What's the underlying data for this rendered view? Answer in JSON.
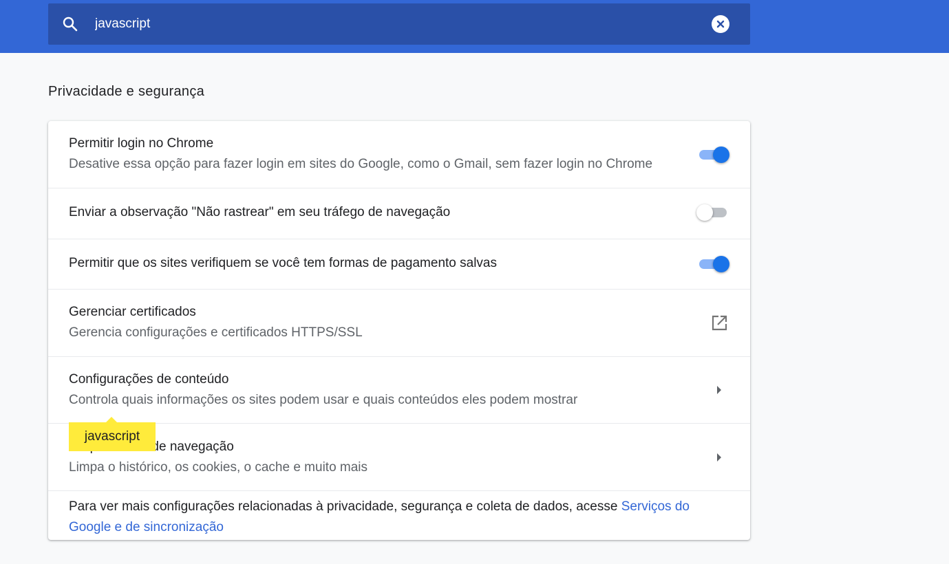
{
  "search": {
    "value": "javascript"
  },
  "section": {
    "title": "Privacidade e segurança"
  },
  "rows": [
    {
      "title": "Permitir login no Chrome",
      "subtitle": "Desative essa opção para fazer login em sites do Google, como o Gmail, sem fazer login no Chrome",
      "control": "toggle",
      "state": "on"
    },
    {
      "title": "Enviar a observação \"Não rastrear\" em seu tráfego de navegação",
      "control": "toggle",
      "state": "off"
    },
    {
      "title": "Permitir que os sites verifiquem se você tem formas de pagamento salvas",
      "control": "toggle",
      "state": "on"
    },
    {
      "title": "Gerenciar certificados",
      "subtitle": "Gerencia configurações e certificados HTTPS/SSL",
      "control": "external-link-icon"
    },
    {
      "title": "Configurações de conteúdo",
      "subtitle": "Controla quais informações os sites podem usar e quais conteúdos eles podem mostrar",
      "control": "chevron-right-icon"
    },
    {
      "title": "Limpar dados de navegação",
      "subtitle": "Limpa o histórico, os cookies, o cache e muito mais",
      "control": "chevron-right-icon"
    }
  ],
  "footer": {
    "text": "Para ver mais configurações relacionadas à privacidade, segurança e coleta de dados, acesse ",
    "link": "Serviços do Google e de sincronização"
  },
  "tooltip": {
    "text": "javascript"
  },
  "colors": {
    "header": "#3367d6",
    "search_bg": "#2a50a8",
    "accent": "#1a73e8",
    "tooltip": "#ffeb3b",
    "link": "#3367d6"
  }
}
